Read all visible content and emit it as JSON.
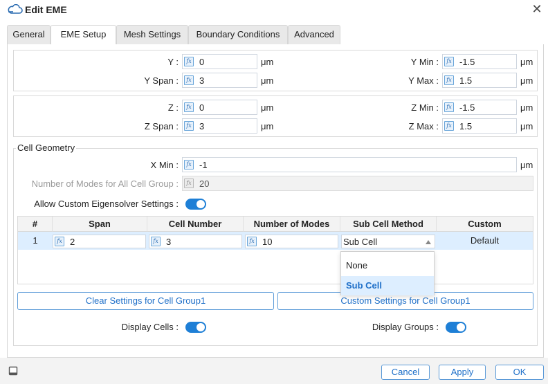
{
  "window": {
    "title": "Edit EME"
  },
  "tabs": [
    {
      "label": "General"
    },
    {
      "label": "EME Setup",
      "active": true
    },
    {
      "label": "Mesh Settings"
    },
    {
      "label": "Boundary Conditions"
    },
    {
      "label": "Advanced"
    }
  ],
  "fx_label": "fx",
  "y_group": {
    "y": {
      "label": "Y :",
      "value": "0",
      "unit": "μm"
    },
    "y_span": {
      "label": "Y Span :",
      "value": "3",
      "unit": "μm"
    },
    "y_min": {
      "label": "Y Min :",
      "value": "-1.5",
      "unit": "μm"
    },
    "y_max": {
      "label": "Y Max :",
      "value": "1.5",
      "unit": "μm"
    }
  },
  "z_group": {
    "z": {
      "label": "Z :",
      "value": "0",
      "unit": "μm"
    },
    "z_span": {
      "label": "Z Span :",
      "value": "3",
      "unit": "μm"
    },
    "z_min": {
      "label": "Z Min :",
      "value": "-1.5",
      "unit": "μm"
    },
    "z_max": {
      "label": "Z Max :",
      "value": "1.5",
      "unit": "μm"
    }
  },
  "cell_geometry": {
    "legend": "Cell Geometry",
    "x_min": {
      "label": "X Min :",
      "value": "-1",
      "unit": "μm"
    },
    "num_modes_all": {
      "label": "Number of Modes for All Cell Group :",
      "value": "20"
    },
    "allow_custom": {
      "label": "Allow Custom Eigensolver Settings :",
      "on": true
    }
  },
  "table": {
    "headers": [
      "#",
      "Span",
      "Cell Number",
      "Number of Modes",
      "Sub Cell Method",
      "Custom"
    ],
    "rows": [
      {
        "index": "1",
        "span": "2",
        "cell_number": "3",
        "num_modes": "10",
        "sub_cell_method": "Sub Cell",
        "custom": "Default"
      }
    ]
  },
  "dropdown_options": [
    "None",
    "Sub Cell"
  ],
  "dropdown_selected": "Sub Cell",
  "buttons": {
    "clear_settings": "Clear Settings for Cell Group1",
    "custom_settings": "Custom Settings for Cell Group1",
    "cancel": "Cancel",
    "apply": "Apply",
    "ok": "OK"
  },
  "display": {
    "cells": {
      "label": "Display Cells :",
      "on": true
    },
    "groups": {
      "label": "Display Groups :",
      "on": true
    }
  },
  "colors": {
    "accent": "#1e7fd6",
    "selected_row": "#ddeeff"
  }
}
